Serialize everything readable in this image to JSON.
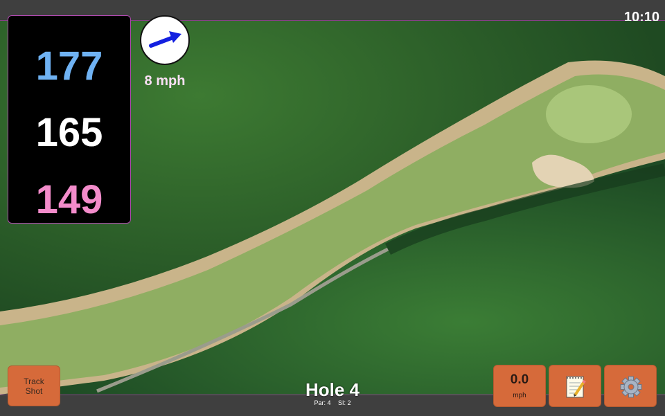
{
  "status_bar": {
    "time": "10:10"
  },
  "distances": {
    "back": "177",
    "middle": "165",
    "front": "149"
  },
  "wind": {
    "speed": "8 mph",
    "direction_icon": "wind-arrow-icon"
  },
  "track_shot": {
    "line1": "Track",
    "line2": "Shot"
  },
  "hole": {
    "title": "Hole 4",
    "par": "Par: 4",
    "si": "SI: 2"
  },
  "speed_button": {
    "value": "0.0",
    "unit": "mph"
  },
  "icons": {
    "notes": "notepad-icon",
    "settings": "gear-icon"
  },
  "colors": {
    "back_distance": "#6fb2f3",
    "middle_distance": "#ffffff",
    "front_distance": "#f38ccb",
    "button": "#d66a3a",
    "accent_border": "#b04ab0"
  }
}
